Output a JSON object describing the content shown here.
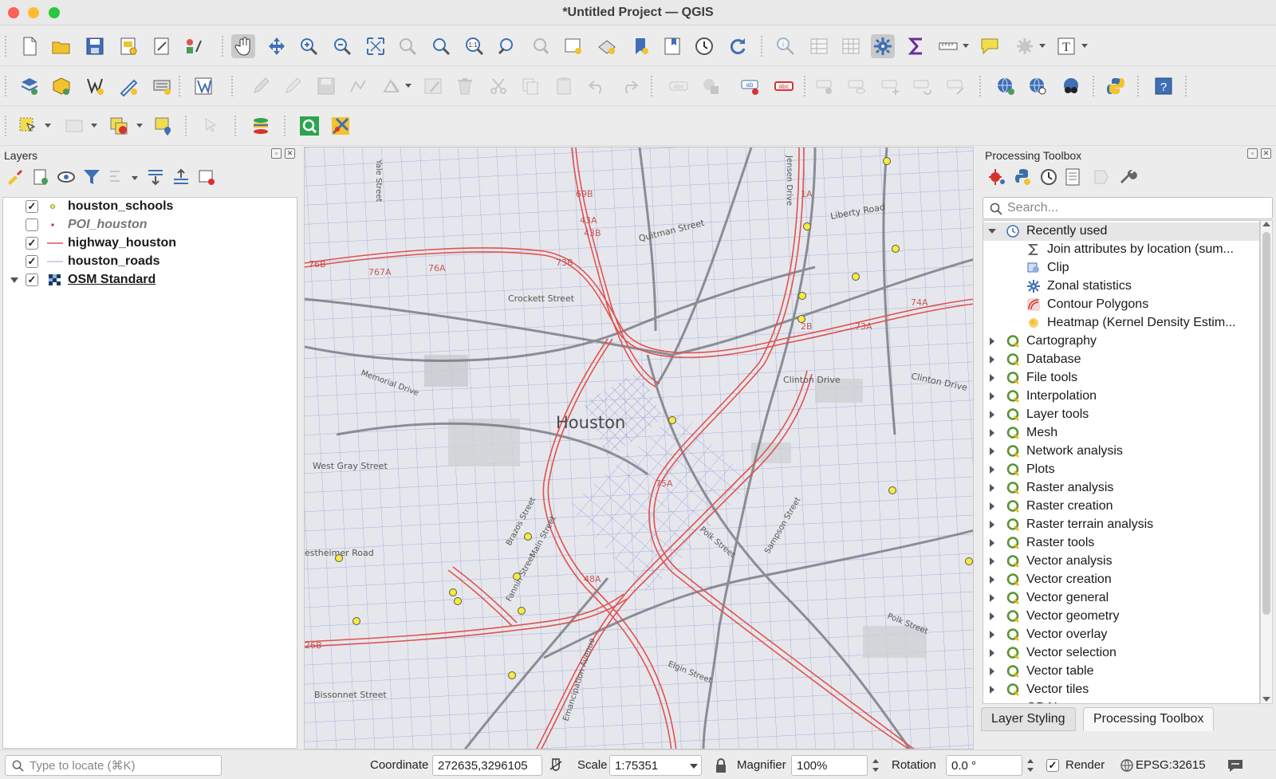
{
  "window": {
    "title": "*Untitled Project — QGIS"
  },
  "layers_panel": {
    "title": "Layers",
    "layers": [
      {
        "name": "houston_schools",
        "checked": true,
        "style": "normal"
      },
      {
        "name": "POI_houston",
        "checked": false,
        "style": "italic"
      },
      {
        "name": "highway_houston",
        "checked": true,
        "style": "normal"
      },
      {
        "name": "houston_roads",
        "checked": true,
        "style": "normal"
      },
      {
        "name": "OSM Standard",
        "checked": true,
        "style": "underline"
      }
    ]
  },
  "map": {
    "labels": {
      "city": "Houston",
      "quitman": "Quitman Street",
      "liberty": "Liberty Road",
      "crockett": "Crockett Street",
      "memorial": "Memorial Drive",
      "clinton": "Clinton Drive",
      "clinton2": "Clinton Drive",
      "westgray": "West Gray Street",
      "westheimer": "estheimer Road",
      "bissonnet": "Bissonnet Street",
      "polk": "Polk Street",
      "polk2": "Polk Street",
      "elgin": "Elgin Street",
      "brazos": "Brazos Street",
      "main": "Main Street",
      "fannin": "Fannin Street",
      "sampson": "Sampson Street",
      "jensen": "Jensen Drive",
      "yale": "Yale Street",
      "emancipation": "Emancipation Avenue",
      "r69b": "69B",
      "r43a": "43A",
      "r43b": "43B",
      "r76b": "76B",
      "r767a": "767A",
      "r76a": "76A",
      "r73b": "73B",
      "r74a": "74A",
      "r26b": "26B",
      "r1a": "1A",
      "r2b": "2B",
      "r48a": "48A",
      "r73a": "73A",
      "r75a": "75A"
    }
  },
  "toolbox": {
    "title": "Processing Toolbox",
    "search_placeholder": "Search...",
    "recent_group": "Recently used",
    "recent": [
      {
        "label": "Join attributes by location (sum...",
        "icon": "sigma-icon"
      },
      {
        "label": "Clip",
        "icon": "clip-icon"
      },
      {
        "label": "Zonal statistics",
        "icon": "gear-icon"
      },
      {
        "label": "Contour Polygons",
        "icon": "contour-icon"
      },
      {
        "label": "Heatmap (Kernel Density Estim...",
        "icon": "heatmap-icon"
      }
    ],
    "groups": [
      "Cartography",
      "Database",
      "File tools",
      "Interpolation",
      "Layer tools",
      "Mesh",
      "Network analysis",
      "Plots",
      "Raster analysis",
      "Raster creation",
      "Raster terrain analysis",
      "Raster tools",
      "Vector analysis",
      "Vector creation",
      "Vector general",
      "Vector geometry",
      "Vector overlay",
      "Vector selection",
      "Vector table",
      "Vector tiles",
      "GDAL"
    ],
    "tabs": [
      "Layer Styling",
      "Processing Toolbox"
    ]
  },
  "statusbar": {
    "locate_placeholder": "Type to locate (⌘K)",
    "coordinate_label": "Coordinate",
    "coordinate_value": "272635,3296105",
    "scale_label": "Scale",
    "scale_value": "1:75351",
    "magnifier_label": "Magnifier",
    "magnifier_value": "100%",
    "rotation_label": "Rotation",
    "rotation_value": "0.0 °",
    "render_label": "Render",
    "render_checked": true,
    "crs": "EPSG:32615"
  },
  "colors": {
    "highway": "#e0524f",
    "roads": "#6b7fe0",
    "schools": "#f5ec3c",
    "map_bg": "#e8e9ed"
  }
}
